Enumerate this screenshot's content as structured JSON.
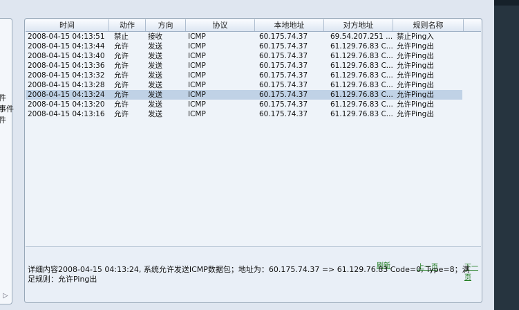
{
  "left_panel": {
    "labels": [
      "件",
      "事件",
      "件"
    ]
  },
  "table": {
    "columns": [
      "时间",
      "动作",
      "方向",
      "协议",
      "本地地址",
      "对方地址",
      "规则名称"
    ],
    "rows": [
      {
        "time": "2008-04-15 04:13:51",
        "action": "禁止",
        "direction": "接收",
        "protocol": "ICMP",
        "local": "60.175.74.37",
        "remote": "69.54.207.251 ...",
        "rule": "禁止Ping入"
      },
      {
        "time": "2008-04-15 04:13:44",
        "action": "允许",
        "direction": "发送",
        "protocol": "ICMP",
        "local": "60.175.74.37",
        "remote": "61.129.76.83 C...",
        "rule": "允许Ping出"
      },
      {
        "time": "2008-04-15 04:13:40",
        "action": "允许",
        "direction": "发送",
        "protocol": "ICMP",
        "local": "60.175.74.37",
        "remote": "61.129.76.83 C...",
        "rule": "允许Ping出"
      },
      {
        "time": "2008-04-15 04:13:36",
        "action": "允许",
        "direction": "发送",
        "protocol": "ICMP",
        "local": "60.175.74.37",
        "remote": "61.129.76.83 C...",
        "rule": "允许Ping出"
      },
      {
        "time": "2008-04-15 04:13:32",
        "action": "允许",
        "direction": "发送",
        "protocol": "ICMP",
        "local": "60.175.74.37",
        "remote": "61.129.76.83 C...",
        "rule": "允许Ping出"
      },
      {
        "time": "2008-04-15 04:13:28",
        "action": "允许",
        "direction": "发送",
        "protocol": "ICMP",
        "local": "60.175.74.37",
        "remote": "61.129.76.83 C...",
        "rule": "允许Ping出"
      },
      {
        "time": "2008-04-15 04:13:24",
        "action": "允许",
        "direction": "发送",
        "protocol": "ICMP",
        "local": "60.175.74.37",
        "remote": "61.129.76.83 C...",
        "rule": "允许Ping出",
        "selected": true
      },
      {
        "time": "2008-04-15 04:13:20",
        "action": "允许",
        "direction": "发送",
        "protocol": "ICMP",
        "local": "60.175.74.37",
        "remote": "61.129.76.83 C...",
        "rule": "允许Ping出"
      },
      {
        "time": "2008-04-15 04:13:16",
        "action": "允许",
        "direction": "发送",
        "protocol": "ICMP",
        "local": "60.175.74.37",
        "remote": "61.129.76.83 C...",
        "rule": "允许Ping出"
      }
    ]
  },
  "footer": {
    "refresh_label": "刷新",
    "prev_label": "上一页",
    "next_label": "下一页",
    "detail_text": "详细内容2008-04-15 04:13:24, 系统允许发送ICMP数据包；地址为：60.175.74.37 => 61.129.76.83 Code=0, Type=8；满足规则：允许Ping出"
  },
  "colors": {
    "selected_row": "#c0d2e6",
    "link_green": "#1c7a1c"
  }
}
